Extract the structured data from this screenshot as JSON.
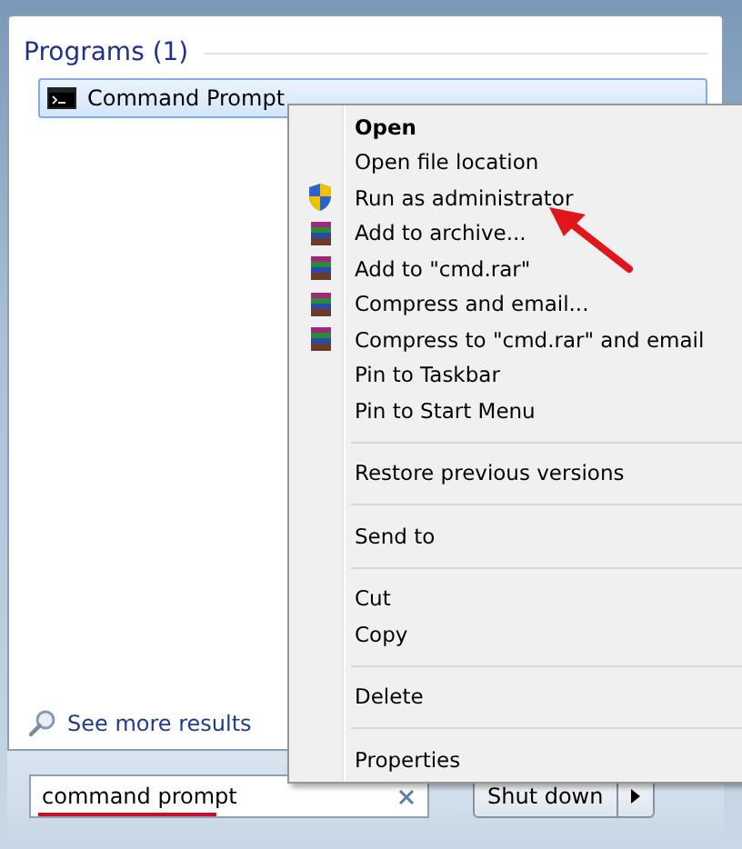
{
  "programs": {
    "heading": "Programs (1)",
    "items": [
      {
        "label": "Command Prompt",
        "selected": true
      }
    ]
  },
  "see_more": "See more results",
  "search": {
    "value": "command prompt"
  },
  "shutdown": {
    "label": "Shut down"
  },
  "context_menu": {
    "groups": [
      [
        {
          "label": "Open",
          "kind": "default"
        },
        {
          "label": "Open file location",
          "kind": "plain"
        },
        {
          "label": "Run as administrator",
          "kind": "shield"
        },
        {
          "label": "Add to archive...",
          "kind": "archive"
        },
        {
          "label": "Add to \"cmd.rar\"",
          "kind": "archive"
        },
        {
          "label": "Compress and email...",
          "kind": "archive"
        },
        {
          "label": "Compress to \"cmd.rar\" and email",
          "kind": "archive"
        },
        {
          "label": "Pin to Taskbar",
          "kind": "plain"
        },
        {
          "label": "Pin to Start Menu",
          "kind": "plain"
        }
      ],
      [
        {
          "label": "Restore previous versions",
          "kind": "plain"
        }
      ],
      [
        {
          "label": "Send to",
          "kind": "plain"
        }
      ],
      [
        {
          "label": "Cut",
          "kind": "plain"
        },
        {
          "label": "Copy",
          "kind": "plain"
        }
      ],
      [
        {
          "label": "Delete",
          "kind": "plain"
        }
      ],
      [
        {
          "label": "Properties",
          "kind": "plain"
        }
      ]
    ]
  }
}
